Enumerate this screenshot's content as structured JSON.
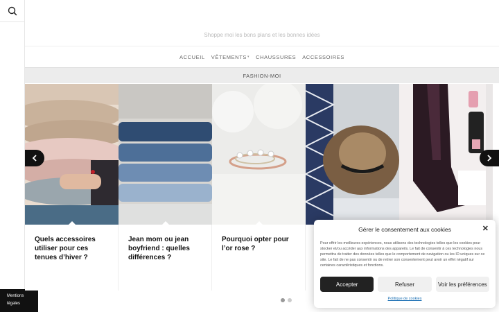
{
  "site": {
    "tagline": "Shoppe moi les bons plans et les bonnes idées"
  },
  "nav": {
    "items": [
      {
        "label": "ACCUEIL"
      },
      {
        "label": "VÊTEMENTS"
      },
      {
        "label": "CHAUSSURES"
      },
      {
        "label": "ACCESSOIRES"
      }
    ]
  },
  "section": {
    "title": "FASHION-MOI"
  },
  "cards": [
    {
      "title": "Quels accessoires utiliser pour ces tenues d’hiver ?"
    },
    {
      "title": "Jean mom ou jean boyfriend : quelles différences ?"
    },
    {
      "title": "Pourquoi opter pour l’or rose ?"
    },
    {
      "title": ""
    },
    {
      "title": ""
    }
  ],
  "sidebar": {
    "legal": [
      "Mentions",
      "légales"
    ]
  },
  "cookie": {
    "title": "Gérer le consentement aux cookies",
    "close": "✕",
    "text": "Pour offrir les meilleures expériences, nous utilisons des technologies telles que les cookies pour stocker et/ou accéder aux informations des appareils. Le fait de consentir à ces technologies nous permettra de traiter des données telles que le comportement de navigation ou les ID uniques sur ce site. Le fait de ne pas consentir ou de retirer son consentement peut avoir un effet négatif sur certaines caractéristiques et fonctions.",
    "accept": "Accepter",
    "refuse": "Refuser",
    "preferences": "Voir les préférences",
    "policy": "Politique de cookies"
  },
  "colors": {
    "accent": "#222222",
    "link": "#1a6fb3"
  },
  "icons": {
    "search": "search-icon",
    "prev": "chevron-left-icon",
    "next": "chevron-right-icon",
    "close": "close-icon"
  }
}
